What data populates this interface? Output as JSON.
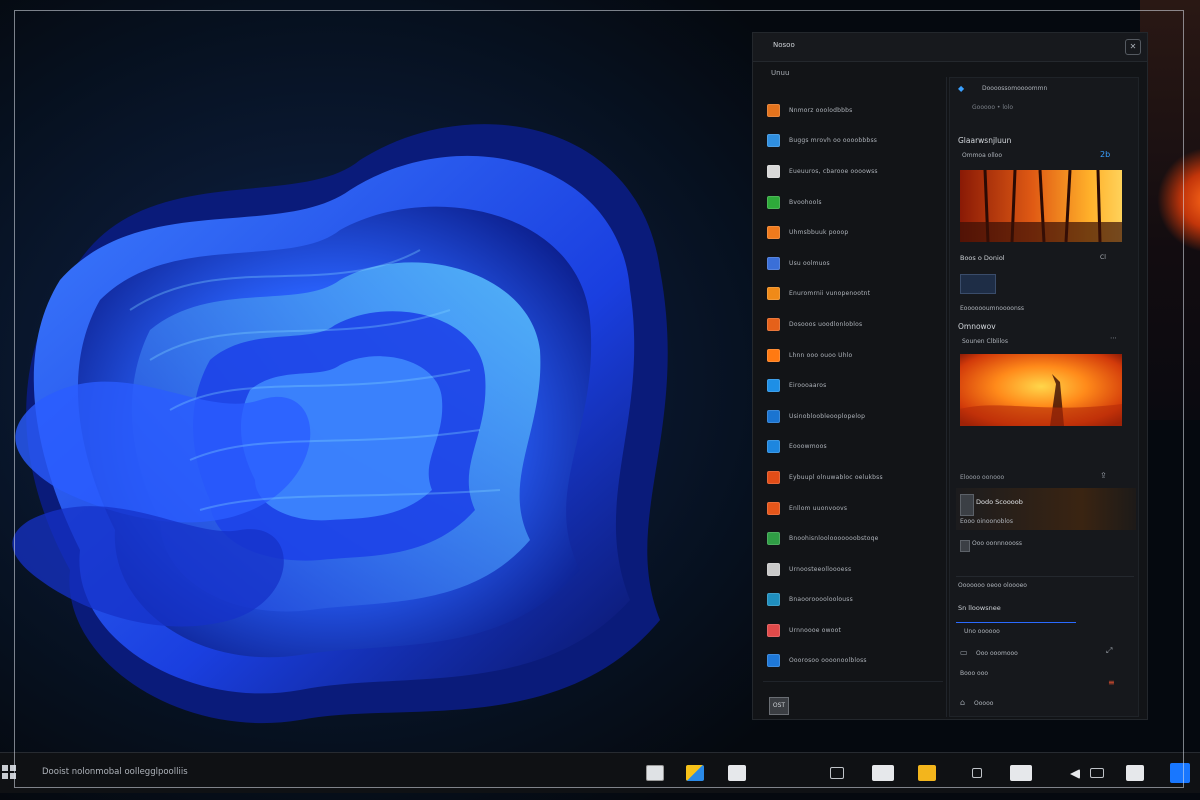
{
  "taskbar": {
    "search_text": "Dooist nolonmobal oollegglpoolliis",
    "icons": [
      "file-explorer-icon",
      "store-icon",
      "window-icon",
      "folder-icon",
      "window-icon",
      "sticky-notes-icon",
      "lock-icon",
      "book-icon",
      "speaker-icon",
      "display-icon",
      "window-icon",
      "notification-icon"
    ]
  },
  "panel": {
    "title": "Nosoo",
    "list_heading": "Unuu",
    "items": [
      {
        "label": "Nnmorz ooolodbbbs",
        "color": "#e3731d"
      },
      {
        "label": "Buggs mrovh oo oooobbbss",
        "color": "#2f8fe0"
      },
      {
        "label": "Eueuuros, cbarooe oooowss",
        "color": "#d8d8d8"
      },
      {
        "label": "Bvoohools",
        "color": "#2eaa3a"
      },
      {
        "label": "Uhmsbbuuk pooop",
        "color": "#f07a1c"
      },
      {
        "label": "Usu oolmuos",
        "color": "#3a6fd8"
      },
      {
        "label": "Enuromrnii vunopenootnt",
        "color": "#f08a18"
      },
      {
        "label": "Dosooos uoodlonloblos",
        "color": "#e5611a"
      },
      {
        "label": "Lhnn ooo ouoo Uhlo",
        "color": "#ff7a12"
      },
      {
        "label": "Eiroooaaros",
        "color": "#1e8fe6"
      },
      {
        "label": "Usinobloobleooplopelop",
        "color": "#1a74d1"
      },
      {
        "label": "Eooowmoos",
        "color": "#1d86df"
      },
      {
        "label": "Eybuupl olnuwabloc oelukbss",
        "color": "#e24d17"
      },
      {
        "label": "Enllom uuonvoovs",
        "color": "#e5561a"
      },
      {
        "label": "Bnoohisnloolooooooobstoqe",
        "color": "#2f9e45"
      },
      {
        "label": "Urnoosteeolloooess",
        "color": "#c9c9c9"
      },
      {
        "label": "Bnaoorooooloolouss",
        "color": "#1f8fbf"
      },
      {
        "label": "Urnnoooe owoot",
        "color": "#e04a4a"
      },
      {
        "label": "Ooorosoo oooonoolbloss",
        "color": "#1e78d8"
      }
    ],
    "footer_icon_label": "OST",
    "detail": {
      "top_title": "Doooossomoooommn",
      "top_sub": "Gooooo • lolo",
      "section1_title": "Glaarwsnjluun",
      "section1_sub": "Ommoa olloo",
      "section1_badge": "2b",
      "image1_caption": "Boos o Doniol",
      "image1_caption_icon": "Cl",
      "small_caption": "Eooooooumnoooonss",
      "section2_title": "Omnowov",
      "section2_sub": "Sounen Clblilos",
      "image2_caption": "Eloooo oonooo",
      "card_title": "Dodo Scoooob",
      "card_sub": "Eooo oinoonoblos",
      "card2_sub": "Ooo oonnnoooss",
      "divider_text": "Ooooooo oeoo oloooeo",
      "row1_title": "Sn lloowsnee",
      "row1_sub": "Uno oooooo",
      "row2_title": "Ooo ooomooo",
      "row2_sub": "Booo ooo",
      "footer_label": "Ooooo"
    }
  },
  "colors": {
    "accent": "#1877ff",
    "wallpaper_blue": "#1d55ff",
    "orange": "#ff6a1a"
  }
}
